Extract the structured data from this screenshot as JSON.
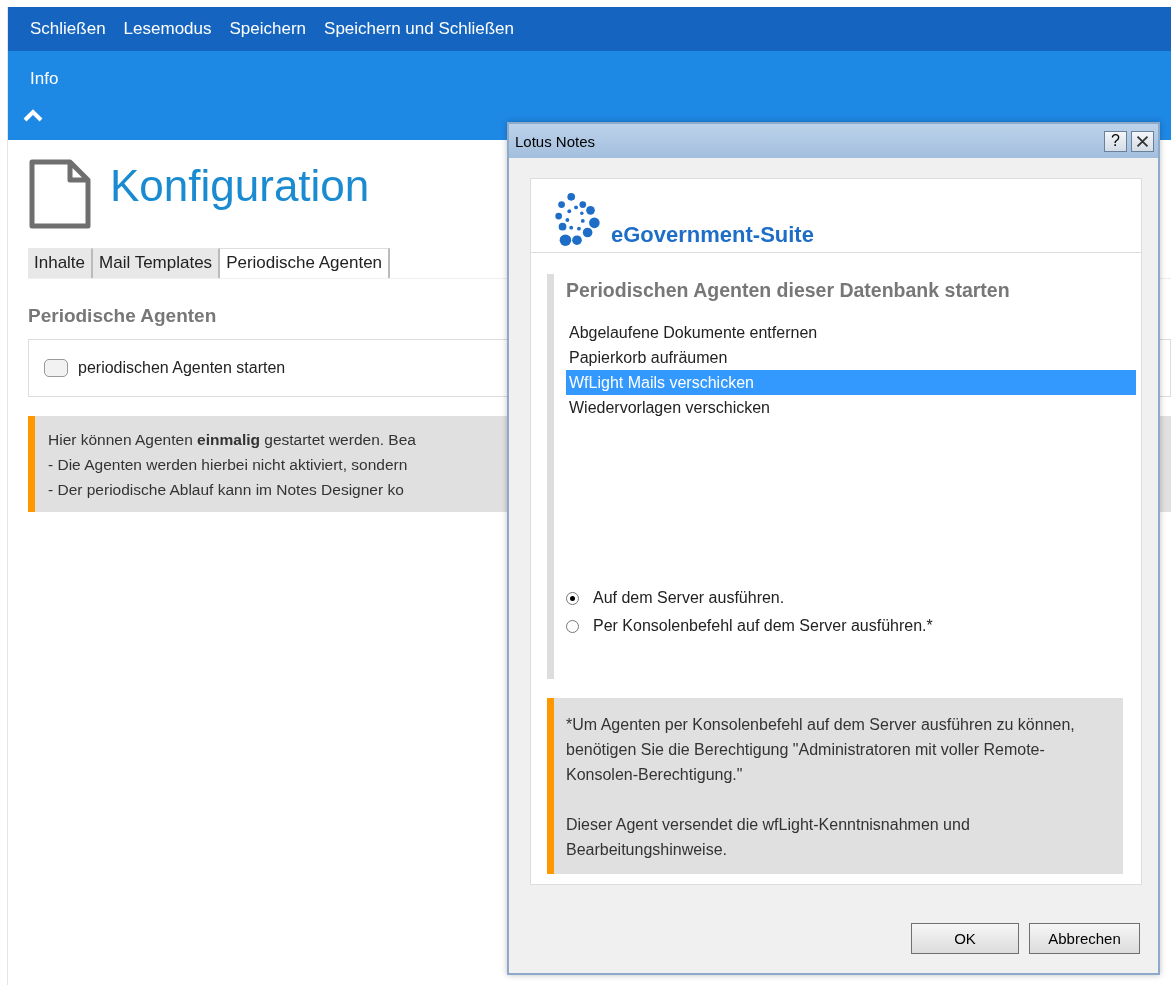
{
  "toolbar": {
    "actions": [
      "Schließen",
      "Lesemodus",
      "Speichern",
      "Speichern und Schließen"
    ]
  },
  "info_bar": {
    "label": "Info",
    "expanded": true
  },
  "document": {
    "title": "Konfiguration",
    "tabs": [
      {
        "label": "Inhalte",
        "selected": false
      },
      {
        "label": "Mail Templates",
        "selected": false
      },
      {
        "label": "Periodische Agenten",
        "selected": true
      }
    ],
    "section_title": "Periodische Agenten",
    "checkbox": {
      "label": "periodischen Agenten starten",
      "checked": false
    },
    "note_lines": [
      "Hier können Agenten **einmalig** gestartet werden. Bea",
      "- Die Agenten werden hierbei nicht aktiviert, sondern",
      "- Der periodische Ablauf kann im Notes Designer ko"
    ]
  },
  "dialog": {
    "title": "Lotus Notes",
    "help_button": "?",
    "logo_text": "eGovernment-Suite",
    "heading": "Periodischen Agenten dieser Datenbank starten",
    "agents": [
      {
        "label": "Abgelaufene Dokumente entfernen",
        "selected": false
      },
      {
        "label": "Papierkorb aufräumen",
        "selected": false
      },
      {
        "label": "WfLight Mails verschicken",
        "selected": true
      },
      {
        "label": "Wiedervorlagen verschicken",
        "selected": false
      }
    ],
    "run_options": [
      {
        "label": "Auf dem Server ausführen.",
        "selected": true
      },
      {
        "label": "Per Konsolenbefehl auf dem Server ausführen.*",
        "selected": false
      }
    ],
    "note_paragraphs": [
      "*Um Agenten per Konsolenbefehl auf dem Server ausführen zu können, benötigen Sie die Berechtigung \"Administratoren mit voller Remote-Konsolen-Berechtigung.\"",
      "Dieser Agent versendet die wfLight-Kenntnisnahmen und Bearbeitungshinweise."
    ],
    "buttons": [
      "OK",
      "Abbrechen"
    ]
  }
}
